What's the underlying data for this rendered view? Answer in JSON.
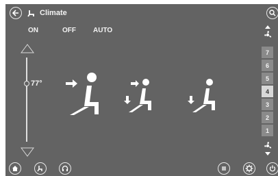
{
  "header": {
    "title": "Climate",
    "back_icon": "back-arrow-icon",
    "search_icon": "search-icon",
    "app_icon": "seat-icon"
  },
  "modes": [
    {
      "label": "ON"
    },
    {
      "label": "OFF"
    },
    {
      "label": "AUTO"
    }
  ],
  "temperature": {
    "value": "77°"
  },
  "airflow_modes": [
    {
      "icon": "airflow-upper-icon"
    },
    {
      "icon": "airflow-upper-lower-icon"
    },
    {
      "icon": "airflow-lower-icon"
    }
  ],
  "fan": {
    "levels": [
      "7",
      "6",
      "5",
      "4",
      "3",
      "2",
      "1"
    ],
    "selected": "4",
    "up_icon": "fan-increase-icon",
    "down_icon": "fan-decrease-icon"
  },
  "bottom_bar": {
    "left_icons": [
      "home-icon",
      "seat-icon",
      "headphones-icon"
    ],
    "right_icons": [
      "menu-icon",
      "settings-icon",
      "power-icon"
    ]
  },
  "colors": {
    "background": "#636363",
    "text": "#f2f2f2",
    "fan_active": "#d8d8d8",
    "fan_inactive": "#8a8a8a"
  }
}
